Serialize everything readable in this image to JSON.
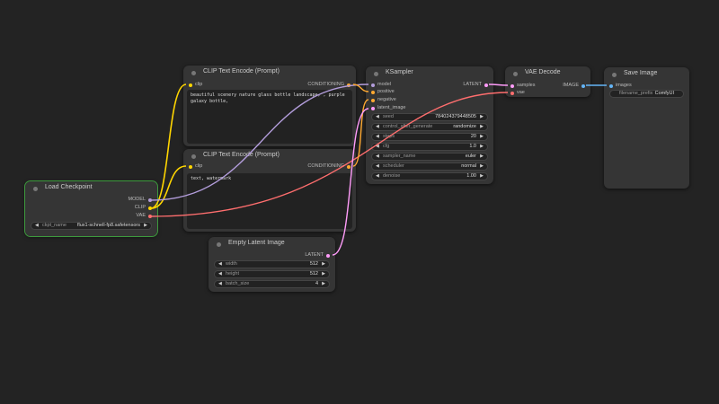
{
  "nodes": {
    "clip1": {
      "title": "CLIP Text Encode (Prompt)",
      "input": "clip",
      "output": "CONDITIONING",
      "text": "beautiful scenery nature glass bottle landscape, , purple galaxy bottle,"
    },
    "clip2": {
      "title": "CLIP Text Encode (Prompt)",
      "input": "clip",
      "output": "CONDITIONING",
      "text": "text, watermark"
    },
    "checkpoint": {
      "title": "Load Checkpoint",
      "outputs": [
        "MODEL",
        "CLIP",
        "VAE"
      ],
      "widget": {
        "name": "ckpt_name",
        "value": "flux1-schnell-fp8.safetensors"
      }
    },
    "latent": {
      "title": "Empty Latent Image",
      "output": "LATENT",
      "widgets": [
        {
          "name": "width",
          "value": "512"
        },
        {
          "name": "height",
          "value": "512"
        },
        {
          "name": "batch_size",
          "value": "4"
        }
      ]
    },
    "ksampler": {
      "title": "KSampler",
      "inputs": [
        "model",
        "positive",
        "negative",
        "latent_image"
      ],
      "output": "LATENT",
      "widgets": [
        {
          "name": "seed",
          "value": "784024379448505"
        },
        {
          "name": "control_after_generate",
          "value": "randomize"
        },
        {
          "name": "steps",
          "value": "20"
        },
        {
          "name": "cfg",
          "value": "1.0"
        },
        {
          "name": "sampler_name",
          "value": "euler"
        },
        {
          "name": "scheduler",
          "value": "normal"
        },
        {
          "name": "denoise",
          "value": "1.00"
        }
      ]
    },
    "vaedecode": {
      "title": "VAE Decode",
      "inputs": [
        "samples",
        "vae"
      ],
      "output": "IMAGE"
    },
    "save": {
      "title": "Save Image",
      "input": "images",
      "widget": {
        "name": "filename_prefix",
        "value": "ComfyUI"
      }
    }
  },
  "colors": {
    "clip": "#ffd500",
    "model": "#b39ddb",
    "vae": "#ff6e6e",
    "conditioning": "#ffa931",
    "latent": "#ff9cf9",
    "image": "#64b5f6",
    "selected": "#3d9a3d"
  }
}
